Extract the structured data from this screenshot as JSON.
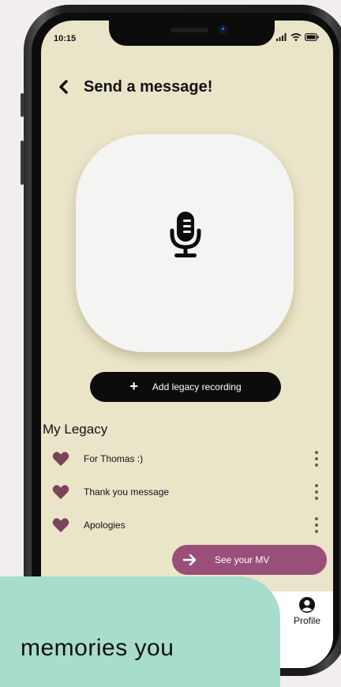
{
  "status_bar": {
    "time": "10:15"
  },
  "header": {
    "title": "Send a message!"
  },
  "actions": {
    "add_recording_label": "Add legacy recording",
    "see_mv_label": "See your MV"
  },
  "legacy": {
    "section_title": "My Legacy",
    "items": [
      {
        "label": "For Thomas :)"
      },
      {
        "label": "Thank you message"
      },
      {
        "label": "Apologies"
      }
    ]
  },
  "bottom_nav": {
    "profile_label": "Profile"
  },
  "banner": {
    "text": "memories you"
  },
  "colors": {
    "screen_bg": "#eae5c9",
    "accent": "#9a4f79",
    "heart": "#7a4458",
    "banner": "#a8dccd"
  }
}
